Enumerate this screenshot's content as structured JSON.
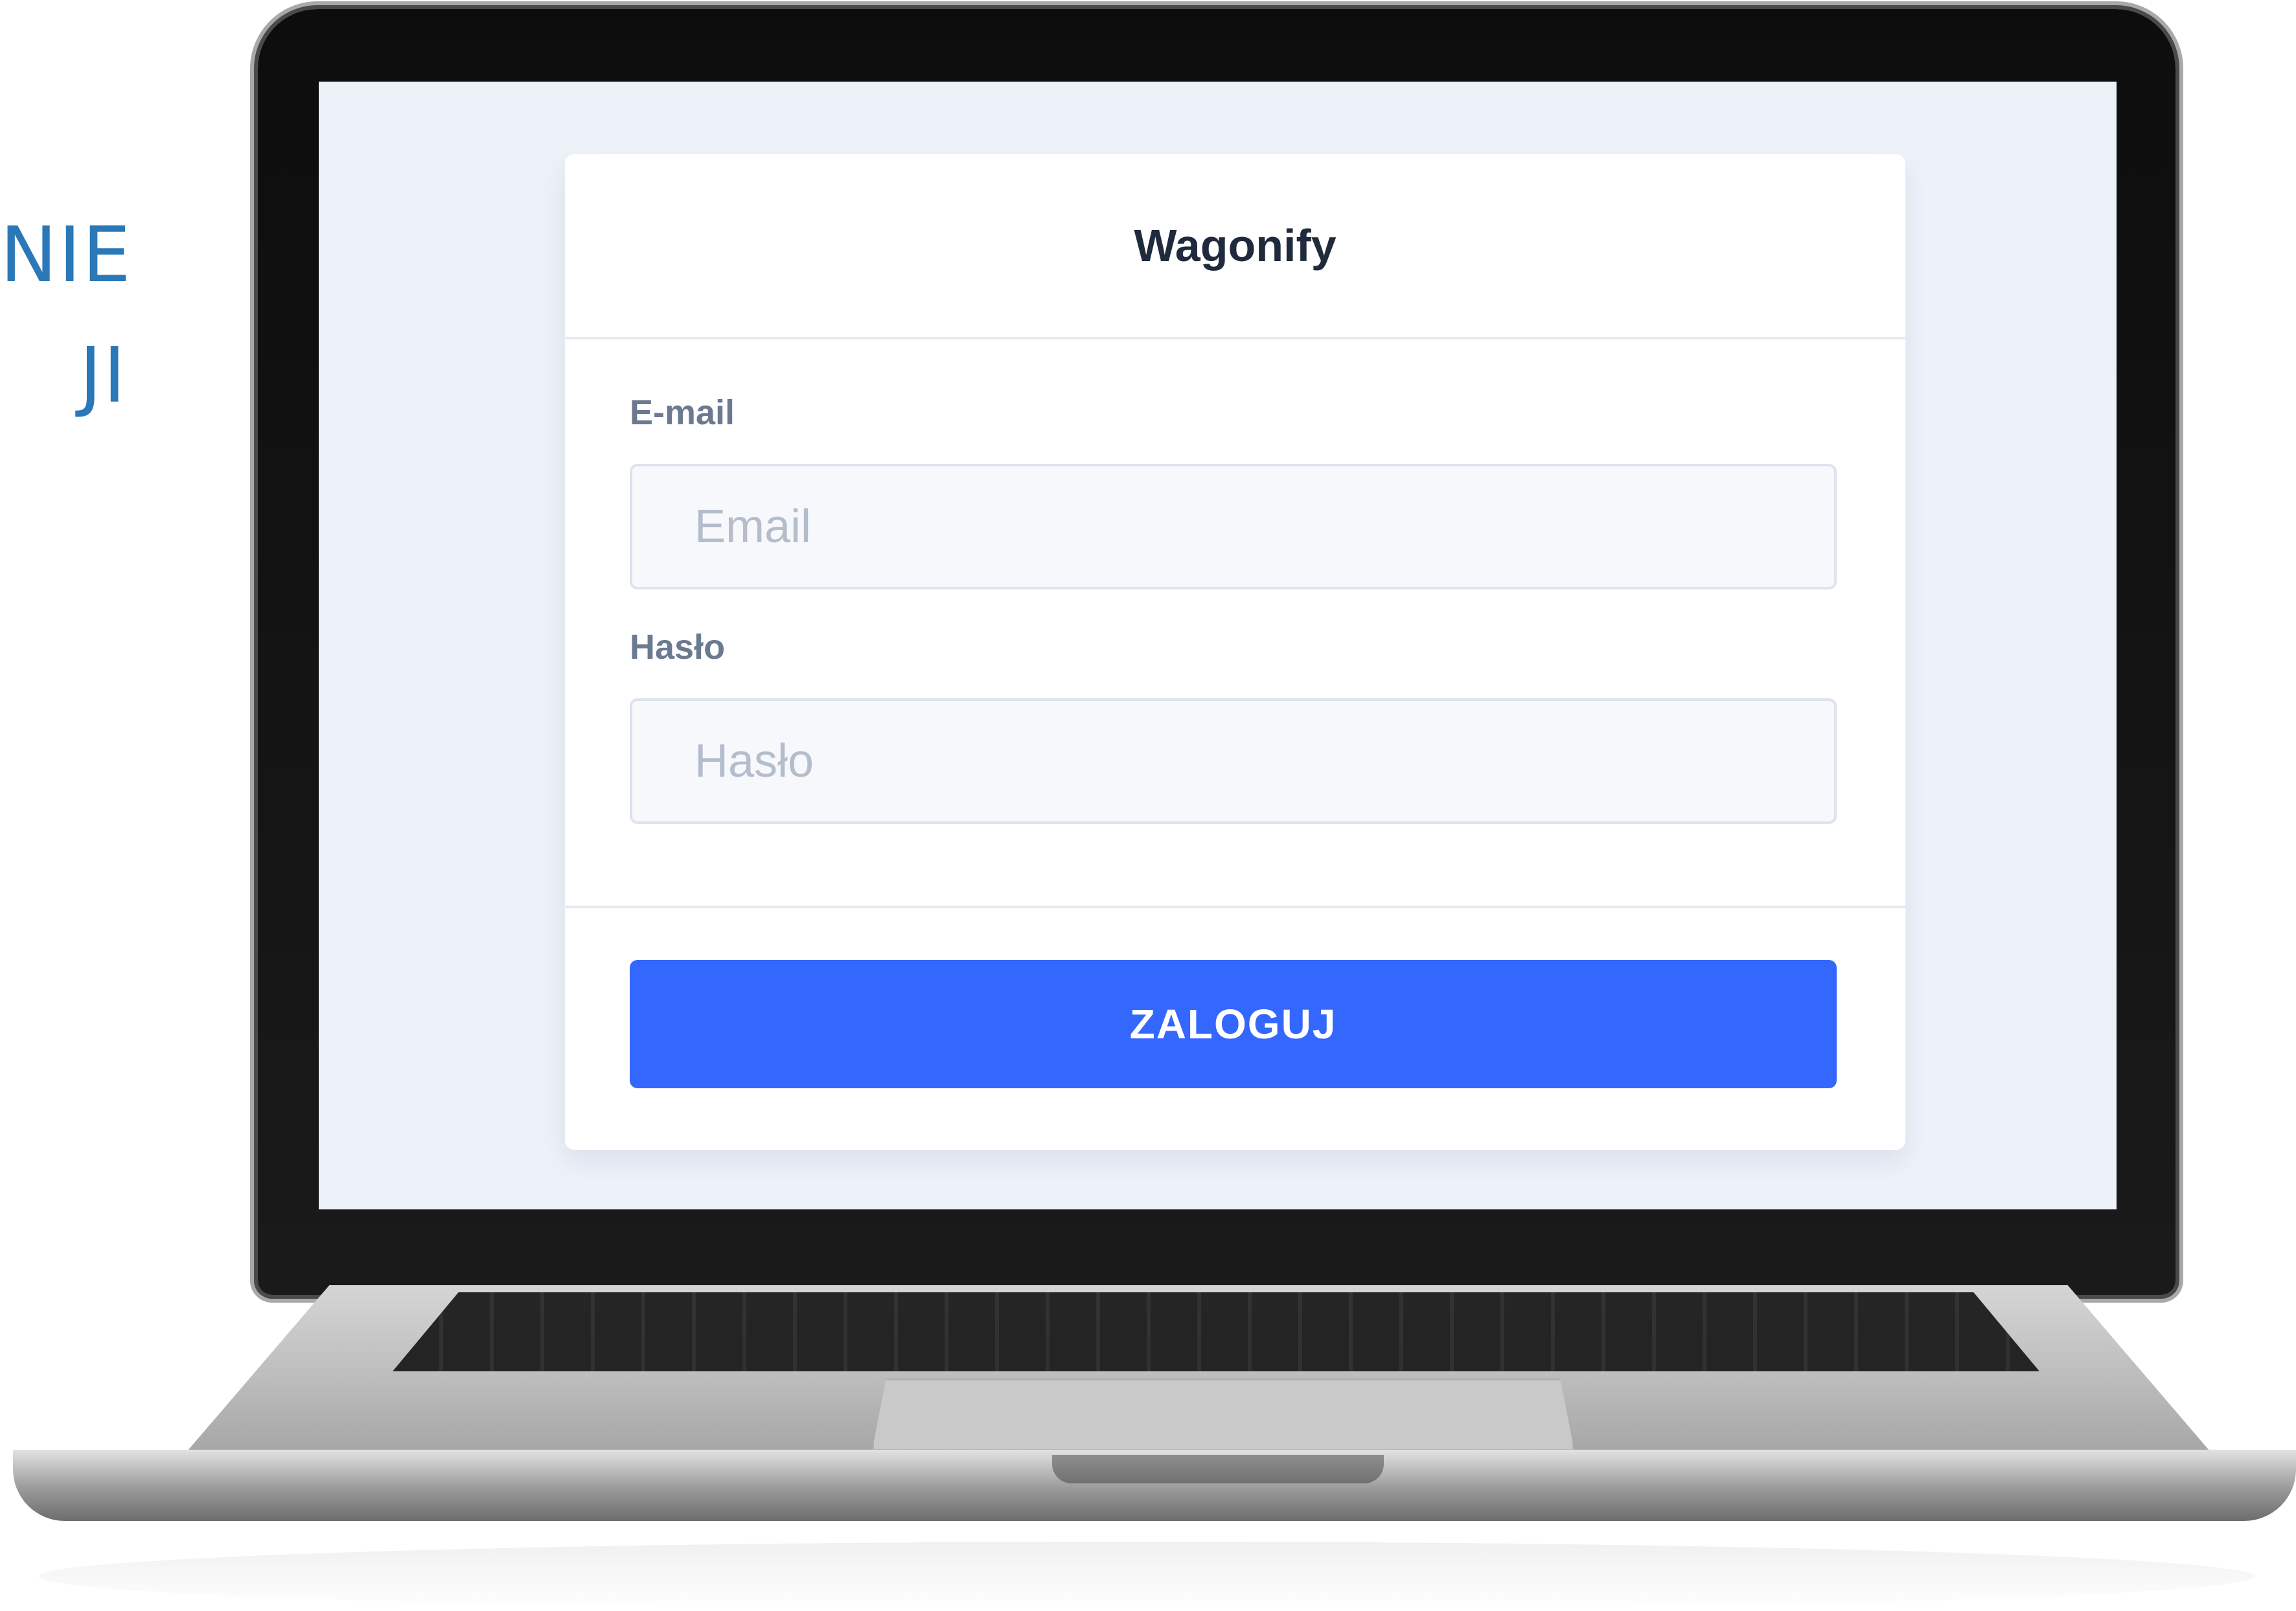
{
  "side_heading": {
    "line1": "NIE",
    "line2": "JI"
  },
  "login": {
    "app_title": "Wagonify",
    "email": {
      "label": "E-mail",
      "placeholder": "Email",
      "value": ""
    },
    "password": {
      "label": "Hasło",
      "placeholder": "Hasło",
      "value": ""
    },
    "submit_label": "ZALOGUJ"
  },
  "colors": {
    "accent": "#3467fe",
    "heading_text": "#2b78b8",
    "screen_background": "#edf1f8"
  }
}
